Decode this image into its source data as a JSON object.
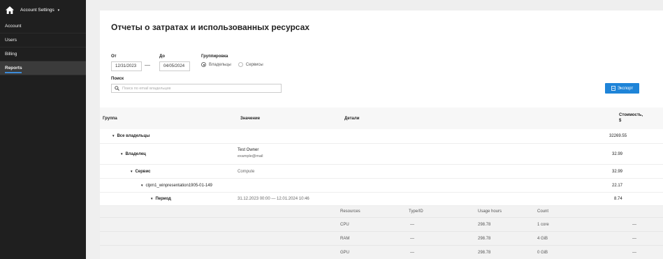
{
  "sidebar": {
    "title": "Account Settings",
    "caret": "▾",
    "items": [
      {
        "label": "Account"
      },
      {
        "label": "Users"
      },
      {
        "label": "Billing"
      },
      {
        "label": "Reports"
      }
    ],
    "active": "Reports",
    "accent_color": "#3d8bd8"
  },
  "page": {
    "title": "Отчеты о затратах и использованных ресурсах",
    "from_label": "От",
    "from_value": "12/31/2023",
    "to_label": "До",
    "to_value": "04/05/2024",
    "dash": "—",
    "grouping_label": "Группировка",
    "grouping_options": [
      "Владельцы",
      "Сервисы"
    ],
    "grouping_selected": "Владельцы",
    "search_label": "Поиск",
    "search_placeholder": "Поиск по email владельцев",
    "export_label": "Экспорт",
    "export_color": "#1e84d8"
  },
  "table": {
    "headers": {
      "group": "Группа",
      "value": "Значение",
      "details": "Детали",
      "cost_line1": "Стоимость,",
      "cost_line2": "$"
    },
    "rows": [
      {
        "group": "Все владельцы",
        "value": "",
        "value2": "",
        "cost": "32269.55"
      },
      {
        "group": "Владелец",
        "value": "Test Owner",
        "value2": "example@mail",
        "cost": "32.99"
      },
      {
        "group": "Сервис",
        "value": "Compute",
        "value2": "",
        "cost": "32.99"
      },
      {
        "group": "clpm1_winpresentation1905-01-149",
        "value": "",
        "value2": "",
        "cost": "22.17"
      },
      {
        "group": "Период",
        "value": "31.12.2023 00:00 — 12.01.2024 10:46",
        "value2": "",
        "cost": "8.74"
      }
    ],
    "detail_headers": {
      "resources": "Resources",
      "type": "Type/ID",
      "hours": "Usage hours",
      "count": "Count"
    },
    "detail_rows": [
      {
        "resource": "CPU",
        "type": "—",
        "hours": "298.78",
        "count": "1 core",
        "cost": "—"
      },
      {
        "resource": "RAM",
        "type": "—",
        "hours": "298.78",
        "count": "4 GiB",
        "cost": "—"
      },
      {
        "resource": "GPU",
        "type": "—",
        "hours": "298.78",
        "count": "0 GiB",
        "cost": "—"
      }
    ]
  }
}
